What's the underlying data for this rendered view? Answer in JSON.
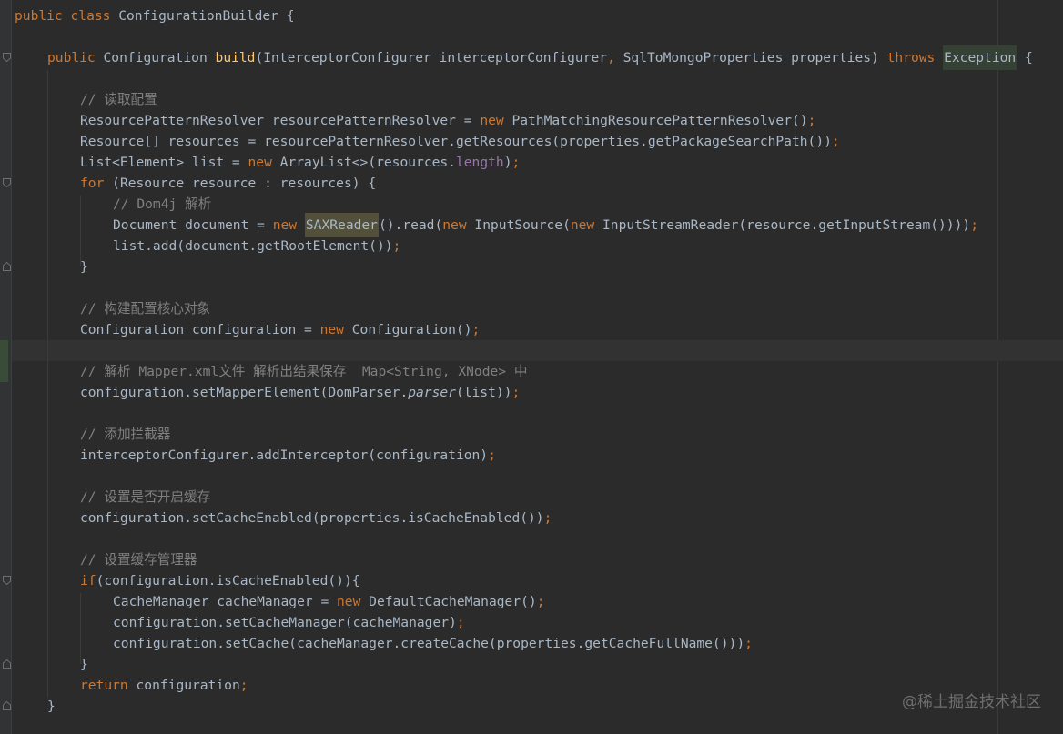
{
  "colors": {
    "background": "#2b2b2b",
    "keyword": "#cc7832",
    "comment": "#808080",
    "method_declaration": "#ffc66d",
    "field": "#9876aa",
    "plain": "#a9b7c6"
  },
  "code": {
    "l1": {
      "t1": "public class ",
      "t2": "ConfigurationBuilder {"
    },
    "l2": {
      "t1": "public ",
      "t2": "Configuration ",
      "t3": "build",
      "t4": "(InterceptorConfigurer interceptorConfigurer",
      "t5": ", ",
      "t6": "SqlToMongoProperties properties) ",
      "t7": "throws ",
      "t8": "Exception",
      "t9": " {"
    },
    "l3": {
      "t1": "// 读取配置"
    },
    "l4": {
      "t1": "ResourcePatternResolver resourcePatternResolver = ",
      "t2": "new ",
      "t3": "PathMatchingResourcePatternResolver()",
      "t4": ";"
    },
    "l5": {
      "t1": "Resource[] resources = resourcePatternResolver.getResources(properties.getPackageSearchPath())",
      "t2": ";"
    },
    "l6": {
      "t1": "List<Element> list = ",
      "t2": "new ",
      "t3": "ArrayList<>(resources.",
      "t4": "length",
      "t5": ")",
      "t6": ";"
    },
    "l7": {
      "t1": "for ",
      "t2": "(Resource resource : resources) {"
    },
    "l8": {
      "t1": "// Dom4j 解析"
    },
    "l9": {
      "t1": "Document document = ",
      "t2": "new ",
      "t3": "SAXReader",
      "t4": "().read(",
      "t5": "new ",
      "t6": "InputSource(",
      "t7": "new ",
      "t8": "InputStreamReader(resource.getInputStream()))",
      "t9": ")",
      "t10": ";"
    },
    "l10": {
      "t1": "list.add(document.getRootElement())",
      "t2": ";"
    },
    "l11": {
      "t1": "}"
    },
    "l12": {
      "t1": "// 构建配置核心对象"
    },
    "l13": {
      "t1": "Configuration configuration = ",
      "t2": "new ",
      "t3": "Configuration()",
      "t4": ";"
    },
    "l14": {
      "t1": "// 解析 Mapper.xml文件 解析出结果保存  Map<String, XNode> 中"
    },
    "l15": {
      "t1": "configuration.setMapperElement(DomParser.",
      "t2": "parser",
      "t3": "(list))",
      "t4": ";"
    },
    "l16": {
      "t1": "// 添加拦截器"
    },
    "l17": {
      "t1": "interceptorConfigurer.addInterceptor(configuration)",
      "t2": ";"
    },
    "l18": {
      "t1": "// 设置是否开启缓存"
    },
    "l19": {
      "t1": "configuration.setCacheEnabled(properties.isCacheEnabled())",
      "t2": ";"
    },
    "l20": {
      "t1": "// 设置缓存管理器"
    },
    "l21": {
      "t1": "if",
      "t2": "(configuration.isCacheEnabled()){"
    },
    "l22": {
      "t1": "CacheManager cacheManager = ",
      "t2": "new ",
      "t3": "DefaultCacheManager()",
      "t4": ";"
    },
    "l23": {
      "t1": "configuration.setCacheManager(cacheManager)",
      "t2": ";"
    },
    "l24": {
      "t1": "configuration.setCache(cacheManager.createCache(properties.getCacheFullName()))",
      "t2": ";"
    },
    "l25": {
      "t1": "}"
    },
    "l26": {
      "t1": "return ",
      "t2": "configuration",
      "t3": ";"
    },
    "l27": {
      "t1": "}"
    }
  },
  "watermark": "@稀土掘金技术社区"
}
